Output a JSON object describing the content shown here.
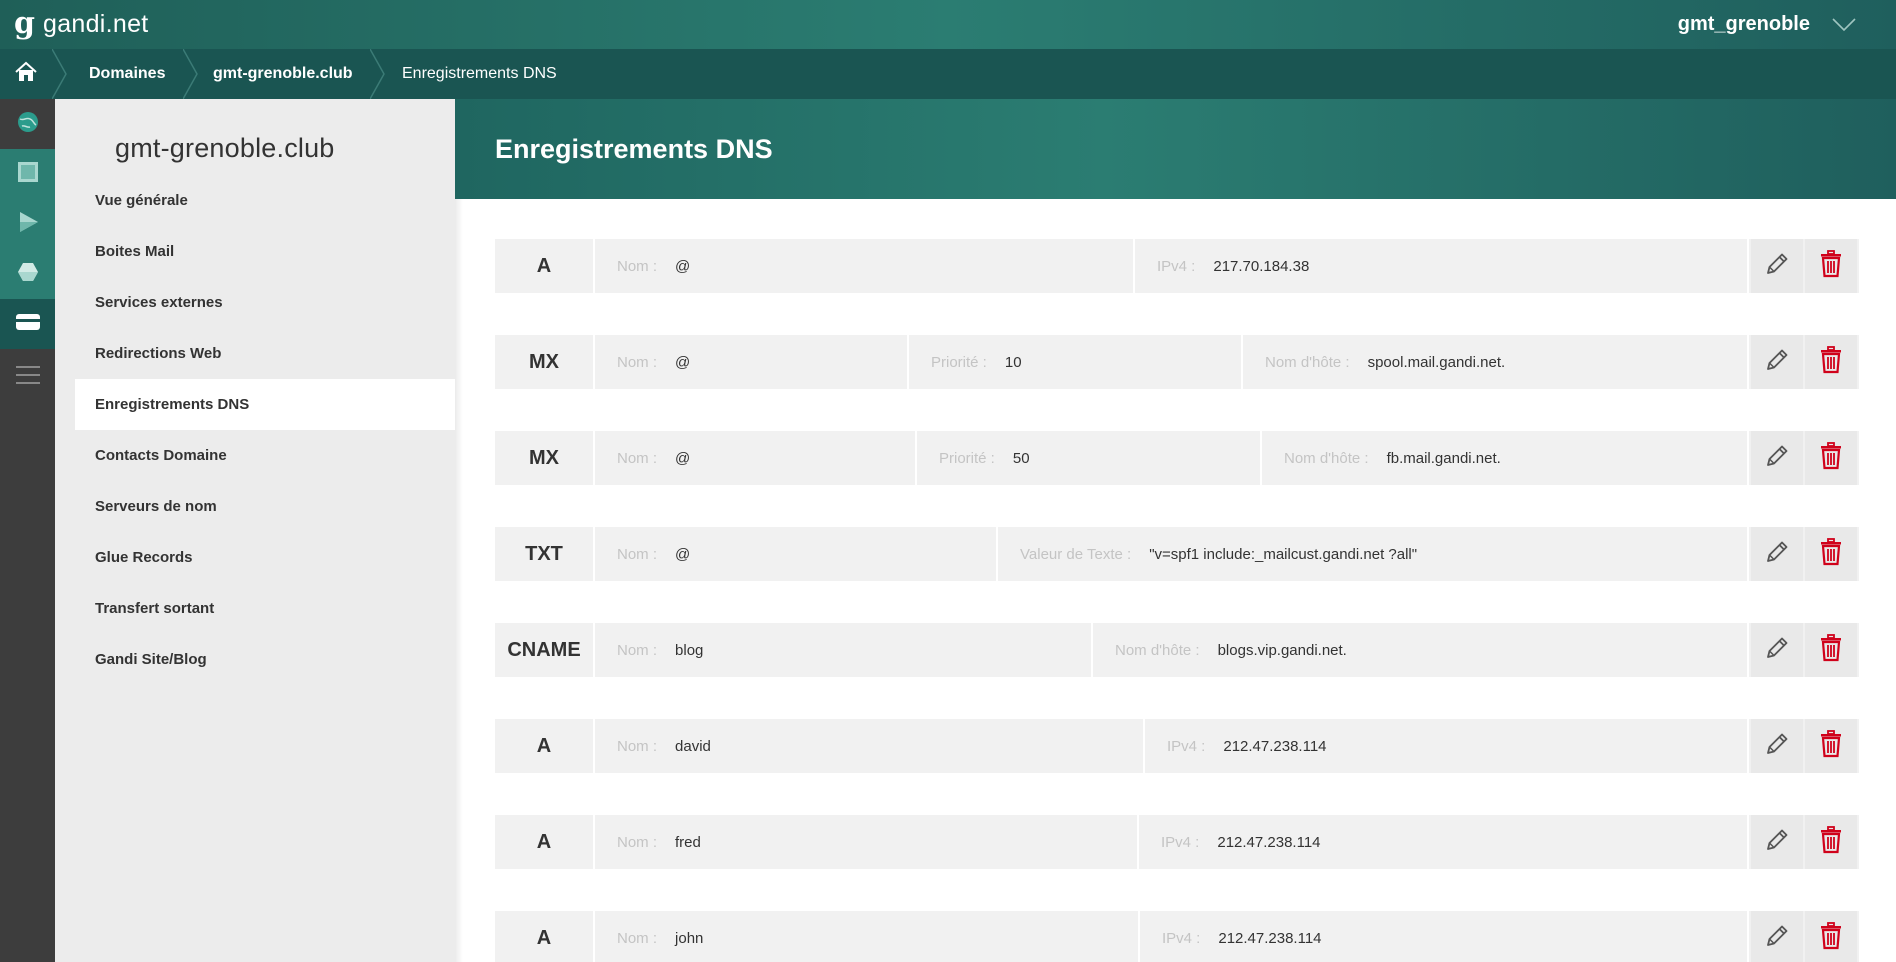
{
  "topbar": {
    "logo_mark": "g",
    "logo_text": "gandi.net",
    "username": "gmt_grenoble",
    "icons": {
      "user_menu": "chevron-down-icon",
      "home": "home-icon"
    }
  },
  "breadcrumb": {
    "items": [
      "Domaines",
      "gmt-grenoble.club",
      "Enregistrements DNS"
    ]
  },
  "rail": {
    "icons": [
      "globe-icon",
      "server-icon",
      "play-icon",
      "hexagon-icon",
      "card-icon",
      "menu-icon"
    ]
  },
  "sidebar": {
    "domain": "gmt-grenoble.club",
    "items": [
      {
        "label": "Vue générale"
      },
      {
        "label": "Boites Mail"
      },
      {
        "label": "Services externes"
      },
      {
        "label": "Redirections Web"
      },
      {
        "label": "Enregistrements DNS",
        "active": true
      },
      {
        "label": "Contacts Domaine"
      },
      {
        "label": "Serveurs de nom"
      },
      {
        "label": "Glue Records"
      },
      {
        "label": "Transfert sortant"
      },
      {
        "label": "Gandi Site/Blog"
      }
    ]
  },
  "main": {
    "title": "Enregistrements DNS",
    "records": [
      {
        "type": "A",
        "fields": [
          {
            "label": "Nom :",
            "value": "@"
          },
          {
            "label": "IPv4 :",
            "value": "217.70.184.38"
          }
        ]
      },
      {
        "type": "MX",
        "fields": [
          {
            "label": "Nom :",
            "value": "@"
          },
          {
            "label": "Priorité :",
            "value": "10"
          },
          {
            "label": "Nom d'hôte :",
            "value": "spool.mail.gandi.net."
          }
        ]
      },
      {
        "type": "MX",
        "fields": [
          {
            "label": "Nom :",
            "value": "@"
          },
          {
            "label": "Priorité :",
            "value": "50"
          },
          {
            "label": "Nom d'hôte :",
            "value": "fb.mail.gandi.net."
          }
        ]
      },
      {
        "type": "TXT",
        "fields": [
          {
            "label": "Nom :",
            "value": "@"
          },
          {
            "label": "Valeur de Texte :",
            "value": "\"v=spf1 include:_mailcust.gandi.net ?all\""
          }
        ]
      },
      {
        "type": "CNAME",
        "fields": [
          {
            "label": "Nom :",
            "value": "blog"
          },
          {
            "label": "Nom d'hôte :",
            "value": "blogs.vip.gandi.net."
          }
        ]
      },
      {
        "type": "A",
        "fields": [
          {
            "label": "Nom :",
            "value": "david"
          },
          {
            "label": "IPv4 :",
            "value": "212.47.238.114"
          }
        ]
      },
      {
        "type": "A",
        "fields": [
          {
            "label": "Nom :",
            "value": "fred"
          },
          {
            "label": "IPv4 :",
            "value": "212.47.238.114"
          }
        ]
      },
      {
        "type": "A",
        "fields": [
          {
            "label": "Nom :",
            "value": "john"
          },
          {
            "label": "IPv4 :",
            "value": "212.47.238.114"
          }
        ]
      }
    ],
    "action_icons": {
      "edit": "pencil-icon",
      "delete": "trash-icon"
    }
  },
  "colors": {
    "teal": "#2b7d72",
    "dark_teal": "#1a5552",
    "delete_red": "#d0021b",
    "rail": "#3d3d3d"
  }
}
